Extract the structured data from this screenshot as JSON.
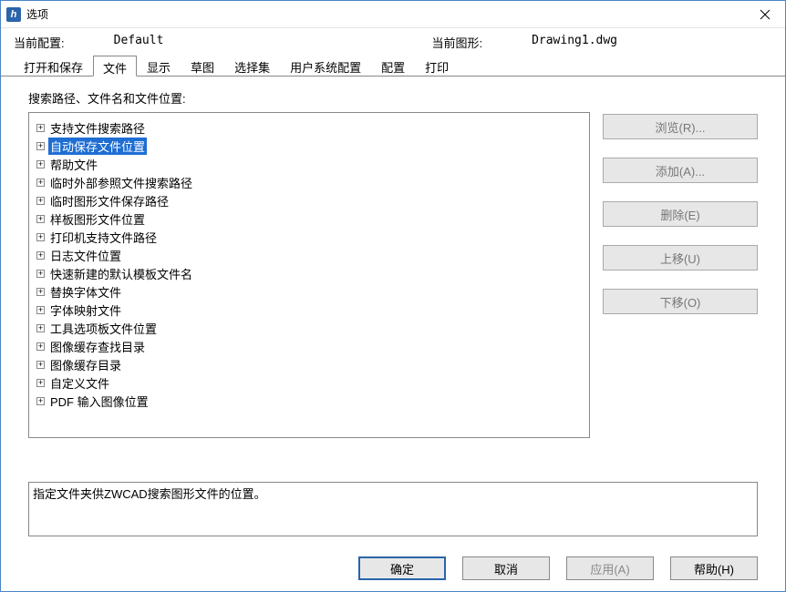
{
  "window": {
    "title": "选项"
  },
  "header": {
    "profile_label": "当前配置:",
    "profile_value": "Default",
    "drawing_label": "当前图形:",
    "drawing_value": "Drawing1.dwg"
  },
  "tabs": [
    {
      "label": "打开和保存"
    },
    {
      "label": "文件"
    },
    {
      "label": "显示"
    },
    {
      "label": "草图"
    },
    {
      "label": "选择集"
    },
    {
      "label": "用户系统配置"
    },
    {
      "label": "配置"
    },
    {
      "label": "打印"
    }
  ],
  "active_tab_index": 1,
  "section_label": "搜索路径、文件名和文件位置:",
  "tree": [
    {
      "label": "支持文件搜索路径"
    },
    {
      "label": "自动保存文件位置"
    },
    {
      "label": "帮助文件"
    },
    {
      "label": "临时外部参照文件搜索路径"
    },
    {
      "label": "临时图形文件保存路径"
    },
    {
      "label": "样板图形文件位置"
    },
    {
      "label": "打印机支持文件路径"
    },
    {
      "label": "日志文件位置"
    },
    {
      "label": "快速新建的默认模板文件名"
    },
    {
      "label": "替换字体文件"
    },
    {
      "label": "字体映射文件"
    },
    {
      "label": "工具选项板文件位置"
    },
    {
      "label": "图像缓存查找目录"
    },
    {
      "label": "图像缓存目录"
    },
    {
      "label": "自定义文件"
    },
    {
      "label": "PDF 输入图像位置"
    }
  ],
  "selected_tree_index": 1,
  "side_buttons": {
    "browse": "浏览(R)...",
    "add": "添加(A)...",
    "delete": "删除(E)",
    "moveup": "上移(U)",
    "movedown": "下移(O)"
  },
  "description": "指定文件夹供ZWCAD搜索图形文件的位置。",
  "footer": {
    "ok": "确定",
    "cancel": "取消",
    "apply": "应用(A)",
    "help": "帮助(H)"
  }
}
